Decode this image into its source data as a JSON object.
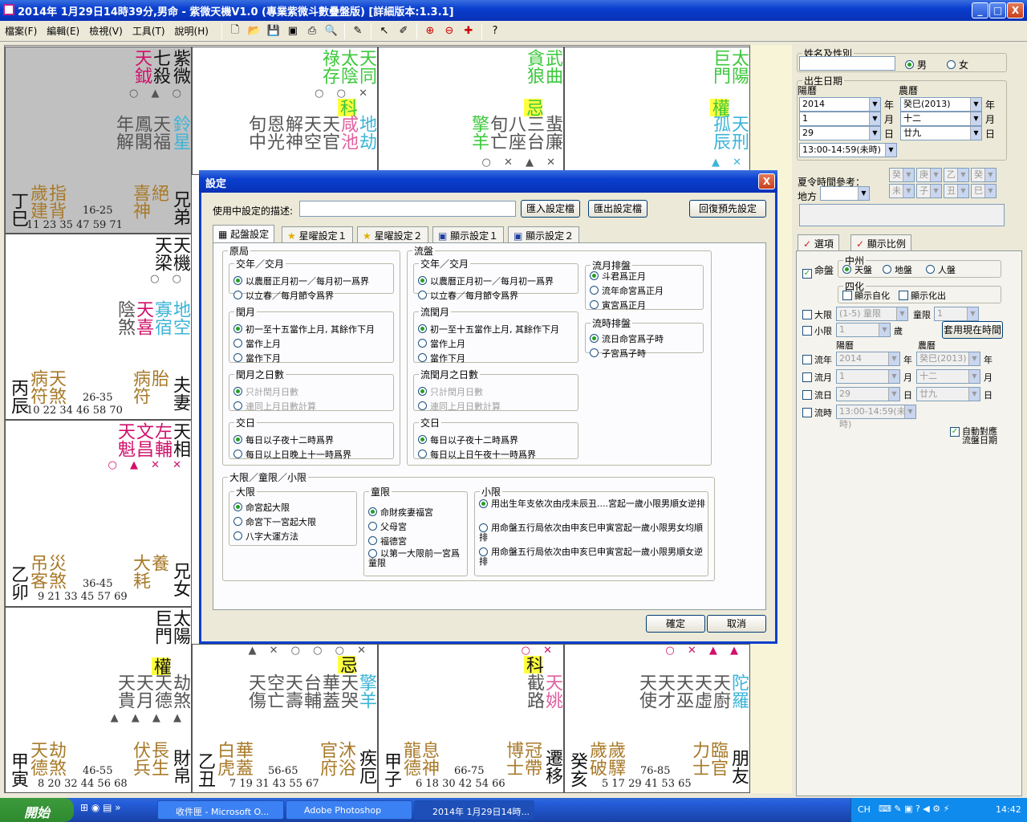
{
  "window": {
    "title": "2014年 1月29日14時39分,男命 - 紫微天機V1.0 (專業紫微斗數疊盤版) [詳細版本:1.3.1]",
    "btn_min": "_",
    "btn_max": "□",
    "btn_close": "X"
  },
  "menu": [
    "檔案(F)",
    "編輯(E)",
    "檢視(V)",
    "工具(T)",
    "說明(H)"
  ],
  "palaces": [
    {
      "id": "si",
      "stem": "丁巳",
      "name": "兄弟",
      "nums": "16-25",
      "nums2": "11 23 35 47 59 71",
      "stars_main": [
        "紫微",
        "七殺"
      ],
      "stars_red": [
        "天鉞"
      ],
      "stars_minor": [
        "鈴星",
        "天福",
        "鳳閣",
        "年解"
      ],
      "bottom": [
        "歲建",
        "指背",
        "喜神",
        "絕"
      ],
      "marks": "○ ▲ ○"
    },
    {
      "id": "wu",
      "stem": "",
      "name": "",
      "nums": "",
      "nums2": "",
      "stars_main": [
        "天同",
        "太陰",
        "祿存"
      ],
      "stars_red": [
        "科"
      ],
      "stars_minor": [
        "地劫",
        "咸池",
        "天官",
        "天空",
        "解神",
        "恩光",
        "旬中"
      ],
      "bottom": [],
      "marks": "○ ○ ✕"
    },
    {
      "id": "wei",
      "stem": "",
      "name": "",
      "nums": "",
      "nums2": "",
      "stars_main": [
        "武曲",
        "貪狼"
      ],
      "stars_red": [
        "忌"
      ],
      "stars_minor": [
        "蜚廉",
        "三台",
        "八座",
        "旬亡",
        "擎羊"
      ],
      "bottom": [],
      "marks": "○ ✕ ▲ ✕"
    },
    {
      "id": "shen",
      "stem": "",
      "name": "",
      "nums": "",
      "nums2": "",
      "stars_main": [
        "太陽",
        "巨門"
      ],
      "stars_red": [
        "權"
      ],
      "stars_minor": [
        "天刑",
        "孤辰"
      ],
      "bottom": [],
      "marks": "▲ ✕"
    },
    {
      "id": "chen",
      "stem": "丙辰",
      "name": "夫妻",
      "nums": "26-35",
      "nums2": "10 22 34 46 58 70",
      "stars_main": [
        "天機",
        "天梁"
      ],
      "stars_red": [
        "天喜"
      ],
      "stars_minor": [
        "地空",
        "寡宿",
        "陰煞"
      ],
      "bottom": [
        "病符",
        "天煞",
        "病符",
        "胎"
      ],
      "marks": "○ ○"
    },
    {
      "id": "mao",
      "stem": "乙卯",
      "name": "兄女",
      "nums": "36-45",
      "nums2": "9 21 33 45 57 69",
      "stars_main": [
        "天相"
      ],
      "stars_red": [
        "左輔",
        "文昌",
        "天魁"
      ],
      "stars_minor": [],
      "bottom": [
        "吊客",
        "災煞",
        "大耗",
        "養"
      ],
      "marks": "○ ▲ ✕ ✕"
    },
    {
      "id": "yin",
      "stem": "甲寅",
      "name": "財帛",
      "nums": "46-55",
      "nums2": "8 20 32 44 56 68",
      "stars_main": [
        "太陽",
        "巨門"
      ],
      "stars_red": [
        "權"
      ],
      "stars_minor": [
        "劫煞",
        "天德",
        "天月",
        "天貴"
      ],
      "bottom": [
        "天德",
        "劫煞",
        "伏兵",
        "長生"
      ],
      "marks": "▲ ▲ ▲ ▲"
    },
    {
      "id": "chou",
      "stem": "乙丑",
      "name": "疾厄",
      "nums": "56-65",
      "nums2": "7 19 31 43 55 67",
      "stars_main": [],
      "stars_red": [
        "忌"
      ],
      "stars_minor": [
        "擎羊",
        "天哭",
        "華蓋",
        "台輔",
        "天壽",
        "空亡",
        "天傷"
      ],
      "bottom": [
        "白虎",
        "華蓋",
        "官府",
        "沐浴"
      ],
      "marks": "▲ ✕ ○ ○ ○ ✕"
    },
    {
      "id": "zi",
      "stem": "甲子",
      "name": "遷移",
      "nums": "66-75",
      "nums2": "6 18 30 42 54 66",
      "stars_main": [],
      "stars_red": [
        "科"
      ],
      "stars_minor": [
        "天姚",
        "截路"
      ],
      "bottom": [
        "龍德",
        "息神",
        "博士",
        "冠帶"
      ],
      "marks": "○ ✕"
    },
    {
      "id": "hai",
      "stem": "癸亥",
      "name": "朋友",
      "nums": "76-85",
      "nums2": "5 17 29 41 53 65",
      "stars_main": [],
      "stars_red": [],
      "stars_minor": [
        "陀羅",
        "天廚",
        "天虛",
        "天巫",
        "天才",
        "天使"
      ],
      "bottom": [
        "歲破",
        "歲驛",
        "力士",
        "臨官"
      ],
      "marks": "○ ✕ ▲ ▲"
    }
  ],
  "right": {
    "name_legend": "姓名及性別",
    "male": "男",
    "female": "女",
    "birth_legend": "出生日期",
    "solar": "陽曆",
    "lunar": "農曆",
    "solar_year": "2014",
    "solar_month": "1",
    "solar_day": "29",
    "lunar_year": "癸巳(2013)",
    "lunar_month": "十二",
    "lunar_day": "廿九",
    "y": "年",
    "m": "月",
    "d": "日",
    "hour": "13:00-14:59(未時)",
    "dst": "夏令時間參考：",
    "place": "地方",
    "gz": [
      "癸",
      "庚",
      "乙",
      "癸",
      "未",
      "子",
      "丑",
      "巳"
    ],
    "tab1": "選項",
    "tab2": "顯示比例",
    "mingpan": "命盤",
    "zhongzhou": "中州",
    "tianpan": "天盤",
    "dipan": "地盤",
    "renpan": "人盤",
    "sihua": "四化",
    "zihua": "顯示自化",
    "huachu": "顯示化出",
    "daxian": "大限",
    "daxian_val": "(1-5) 童限",
    "tongxian": "童限",
    "tongxian_val": "1",
    "xiaoxian": "小限",
    "xiaoxian_val": "1",
    "sui": "歲",
    "use_now": "套用現在時間",
    "liunian": "流年",
    "liunian_val": "2014",
    "liunian_lunar": "癸巳(2013)",
    "liuyue": "流月",
    "liuyue_val": "1",
    "liuyue_lunar": "十二",
    "liuri": "流日",
    "liuri_val": "29",
    "liuri_lunar": "廿九",
    "liushi": "流時",
    "liushi_val": "13:00-14:59(未時)",
    "auto": "自動對應流盤日期"
  },
  "dialog": {
    "title": "設定",
    "close": "X",
    "desc_label": "使用中設定的描述:",
    "desc_value": "",
    "import": "匯入設定檔",
    "export": "匯出設定檔",
    "restore": "回復預先設定",
    "tabs": [
      "起盤設定",
      "星曜設定１",
      "星曜設定２",
      "顯示設定１",
      "顯示設定２"
    ],
    "yuanju": "原局",
    "liupan": "流盤",
    "jiaonian": "交年／交月",
    "jn1": "以農曆正月初一／每月初一爲界",
    "jn2": "以立春／每月節令爲界",
    "runyue": "閏月",
    "ry1": "初一至十五當作上月, 其餘作下月",
    "ry2": "當作上月",
    "ry3": "當作下月",
    "liurunyue": "流閏月",
    "runyueday": "閏月之日數",
    "rd1": "只計閏月日數",
    "rd2": "連同上月日數計算",
    "liurunyueday": "流閏月之日數",
    "jiaori": "交日",
    "jr1": "每日以子夜十二時爲界",
    "jr2": "每日以上日晚上十一時爲界",
    "jr2b": "每日以上日午夜十一時爲界",
    "liuyuepai": "流月排盤",
    "ly1": "斗君爲正月",
    "ly2": "流年命宮爲正月",
    "ly3": "寅宮爲正月",
    "liushipai": "流時排盤",
    "ls1": "流日命宮爲子時",
    "ls2": "子宮爲子時",
    "xiangroup": "大限／童限／小限",
    "dx": "大限",
    "dx1": "命宮起大限",
    "dx2": "命宮下一宮起大限",
    "dx3": "八字大運方法",
    "tx": "童限",
    "tx1": "命財疾妻福宮",
    "tx2": "父母宮",
    "tx3": "福德宮",
    "tx4": "以第一大限前一宮爲童限",
    "xx": "小限",
    "xx1": "用出生年支依次由戌未辰丑....宮起一歲小限男順女逆排",
    "xx2": "用命盤五行局依次由申亥巳申寅宮起一歲小限男女均順排",
    "xx3": "用命盤五行局依次由申亥巳申寅宮起一歲小限男順女逆排",
    "ok": "確定",
    "cancel": "取消"
  },
  "taskbar": {
    "start": "開始",
    "tasks": [
      "收件匣 - Microsoft O...",
      "Adobe Photoshop",
      "2014年 1月29日14時..."
    ],
    "lang": "CH",
    "time": "14:42"
  }
}
